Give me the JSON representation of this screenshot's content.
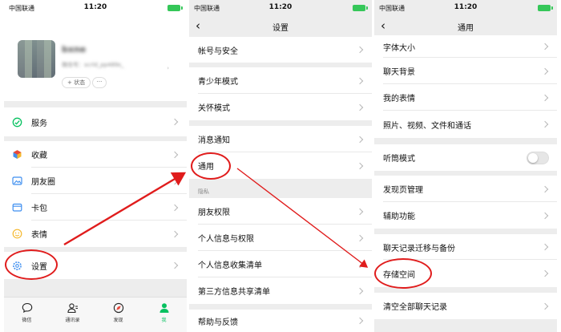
{
  "status": {
    "carrier": "中国联通",
    "time": "11:20"
  },
  "profile": {
    "nickname": "bxne",
    "wechat_id": "微信号：scrld_pp489s_",
    "status_label": "+ 状态",
    "more_label": "···"
  },
  "me_menu": [
    {
      "label": "服务",
      "icon": "service-icon"
    },
    {
      "label": "收藏",
      "icon": "favorites-icon"
    },
    {
      "label": "朋友圈",
      "icon": "moments-icon"
    },
    {
      "label": "卡包",
      "icon": "cards-icon"
    },
    {
      "label": "表情",
      "icon": "stickers-icon"
    },
    {
      "label": "设置",
      "icon": "settings-icon"
    }
  ],
  "tabbar": [
    {
      "label": "微信",
      "icon": "chat-icon"
    },
    {
      "label": "通讯录",
      "icon": "contacts-icon"
    },
    {
      "label": "发现",
      "icon": "discover-icon"
    },
    {
      "label": "我",
      "icon": "me-icon"
    }
  ],
  "settings": {
    "title": "设置",
    "items": [
      "帐号与安全",
      "青少年模式",
      "关怀模式",
      "消息通知",
      "通用"
    ],
    "privacy_header": "隐私",
    "privacy_items": [
      "朋友权限",
      "个人信息与权限",
      "个人信息收集清单",
      "第三方信息共享清单"
    ],
    "help_label": "帮助与反馈"
  },
  "general": {
    "title": "通用",
    "items": [
      "字体大小",
      "聊天背景",
      "我的表情",
      "照片、视频、文件和通话",
      "听筒模式",
      "发现页管理",
      "辅助功能",
      "聊天记录迁移与备份",
      "存储空间",
      "清空全部聊天记录"
    ]
  },
  "colors": {
    "accent": "#07c160",
    "annotation": "#e01c1c",
    "battery": "#35c759"
  }
}
